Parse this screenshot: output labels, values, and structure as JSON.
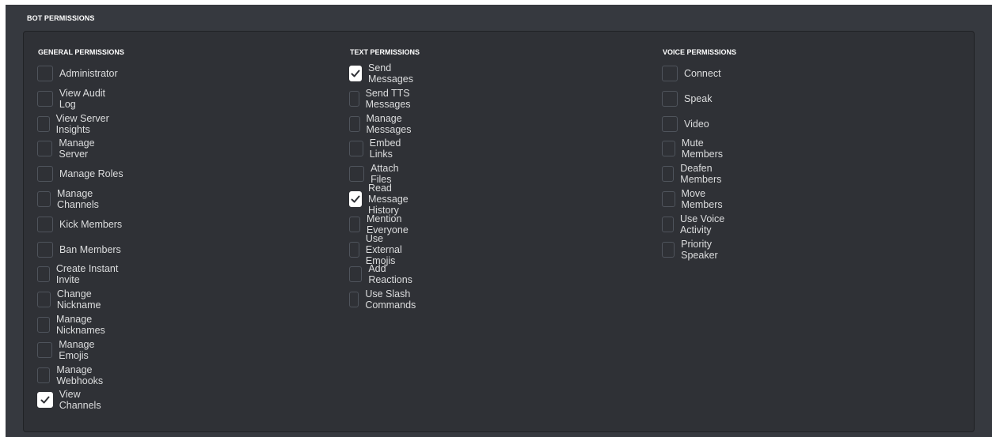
{
  "section_title": "BOT PERMISSIONS",
  "columns": [
    {
      "title": "GENERAL PERMISSIONS",
      "items": [
        {
          "label": "Administrator",
          "checked": false
        },
        {
          "label": "View Audit Log",
          "checked": false
        },
        {
          "label": "View Server Insights",
          "checked": false
        },
        {
          "label": "Manage Server",
          "checked": false
        },
        {
          "label": "Manage Roles",
          "checked": false
        },
        {
          "label": "Manage Channels",
          "checked": false
        },
        {
          "label": "Kick Members",
          "checked": false
        },
        {
          "label": "Ban Members",
          "checked": false
        },
        {
          "label": "Create Instant Invite",
          "checked": false
        },
        {
          "label": "Change Nickname",
          "checked": false
        },
        {
          "label": "Manage Nicknames",
          "checked": false
        },
        {
          "label": "Manage Emojis",
          "checked": false
        },
        {
          "label": "Manage Webhooks",
          "checked": false
        },
        {
          "label": "View Channels",
          "checked": true
        }
      ]
    },
    {
      "title": "TEXT PERMISSIONS",
      "items": [
        {
          "label": "Send Messages",
          "checked": true
        },
        {
          "label": "Send TTS Messages",
          "checked": false
        },
        {
          "label": "Manage Messages",
          "checked": false
        },
        {
          "label": "Embed Links",
          "checked": false
        },
        {
          "label": "Attach Files",
          "checked": false
        },
        {
          "label": "Read Message History",
          "checked": true
        },
        {
          "label": "Mention Everyone",
          "checked": false
        },
        {
          "label": "Use External Emojis",
          "checked": false
        },
        {
          "label": "Add Reactions",
          "checked": false
        },
        {
          "label": "Use Slash Commands",
          "checked": false
        }
      ]
    },
    {
      "title": "VOICE PERMISSIONS",
      "items": [
        {
          "label": "Connect",
          "checked": false
        },
        {
          "label": "Speak",
          "checked": false
        },
        {
          "label": "Video",
          "checked": false
        },
        {
          "label": "Mute Members",
          "checked": false
        },
        {
          "label": "Deafen Members",
          "checked": false
        },
        {
          "label": "Move Members",
          "checked": false
        },
        {
          "label": "Use Voice Activity",
          "checked": false
        },
        {
          "label": "Priority Speaker",
          "checked": false
        }
      ]
    }
  ]
}
